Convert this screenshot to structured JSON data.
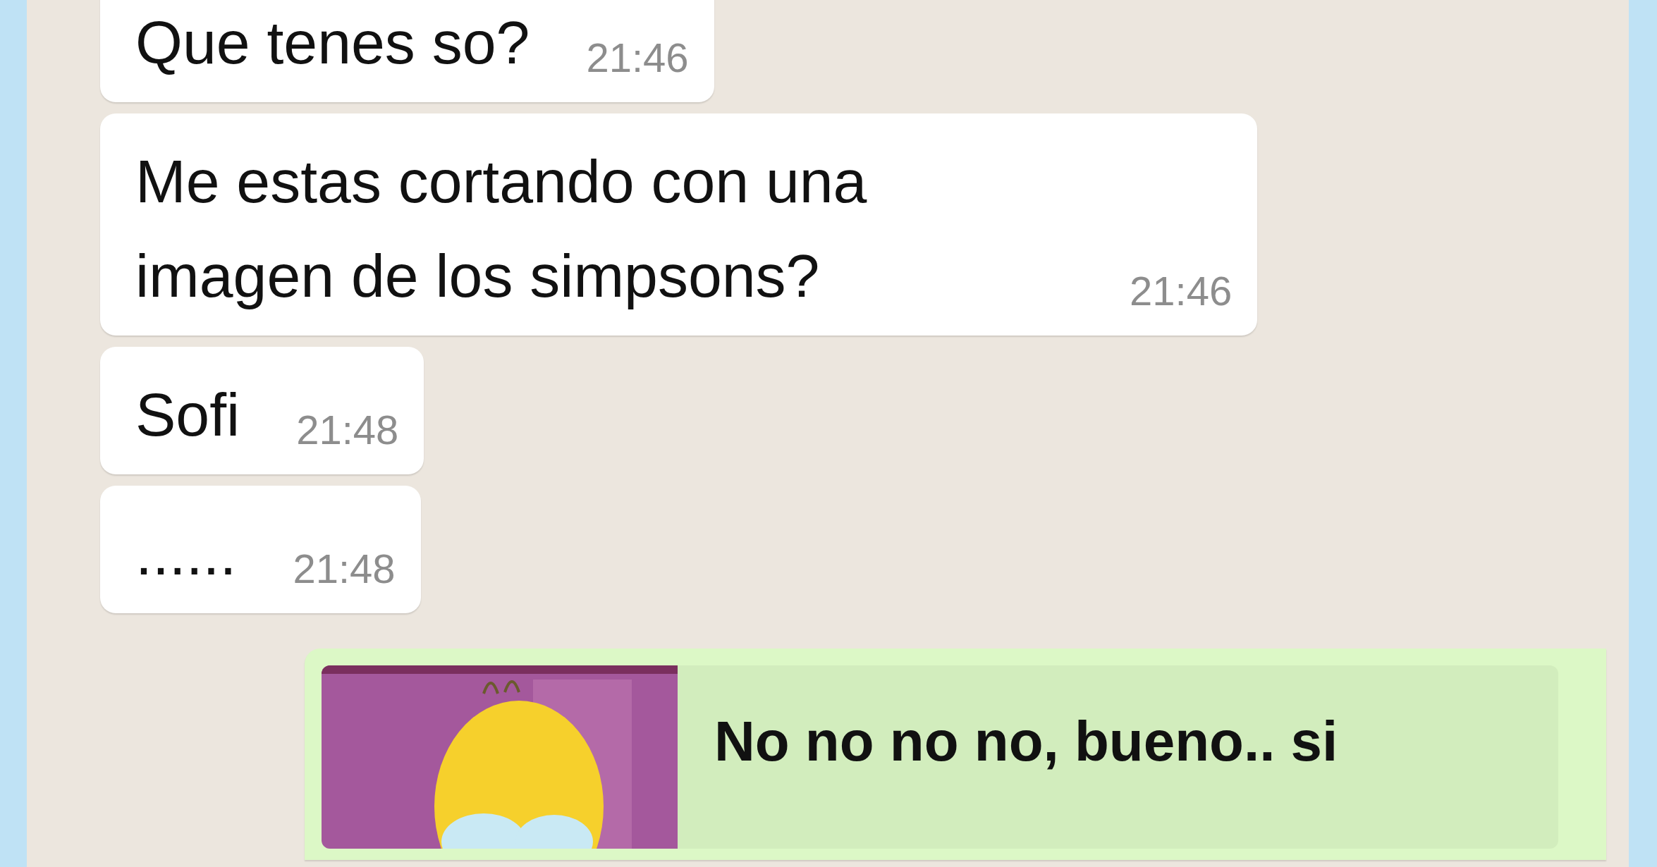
{
  "messages": [
    {
      "outgoing": false,
      "text": "Que tenes so?",
      "time": "21:46"
    },
    {
      "outgoing": false,
      "text": "Me estas cortando con una imagen de los simpsons?",
      "time": "21:46"
    },
    {
      "outgoing": false,
      "text": "Sofi",
      "time": "21:48"
    },
    {
      "outgoing": false,
      "text": "......",
      "time": "21:48"
    }
  ],
  "reply": {
    "outgoing": true,
    "quote": {
      "kind": "picture",
      "caption": "No no no no, bueno.. si"
    }
  }
}
